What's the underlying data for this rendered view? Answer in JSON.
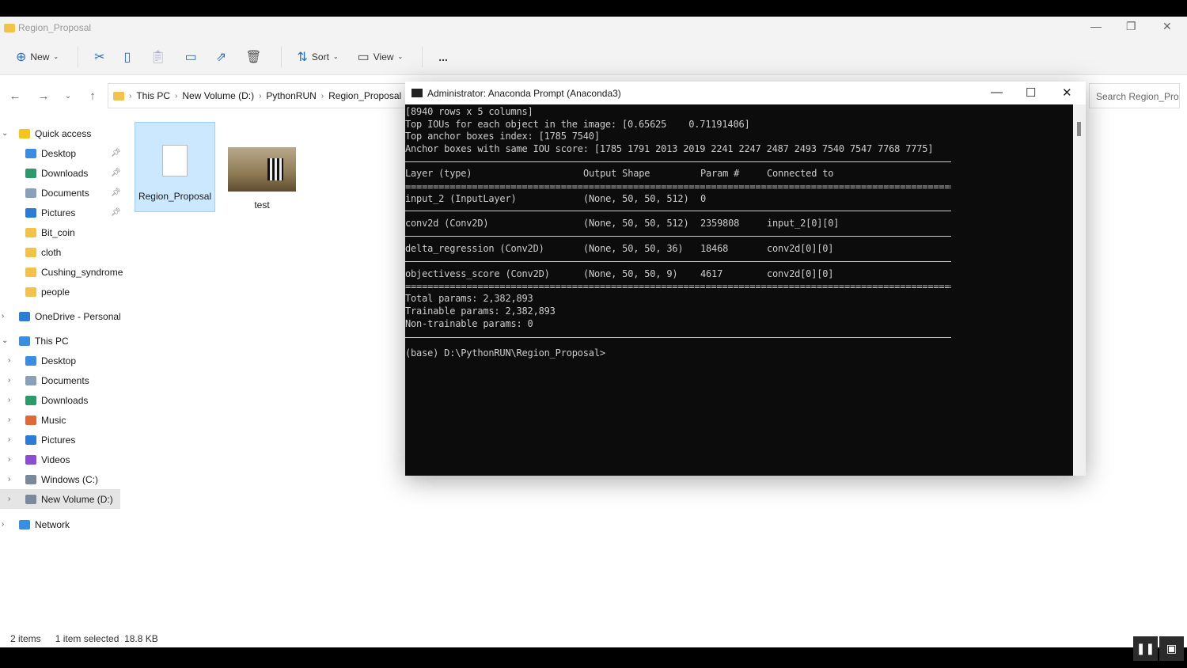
{
  "explorer": {
    "title": "Region_Proposal",
    "toolbar": {
      "new": "New",
      "sort": "Sort",
      "view": "View",
      "more": "..."
    },
    "breadcrumb": [
      "This PC",
      "New Volume (D:)",
      "PythonRUN",
      "Region_Proposal"
    ],
    "search_placeholder": "Search Region_Pro...",
    "sidebar": {
      "quick_access": "Quick access",
      "quick_items": [
        {
          "label": "Desktop",
          "pinned": true,
          "color": "#3a8de0"
        },
        {
          "label": "Downloads",
          "pinned": true,
          "color": "#2c9a6a"
        },
        {
          "label": "Documents",
          "pinned": true,
          "color": "#8aa0b8"
        },
        {
          "label": "Pictures",
          "pinned": true,
          "color": "#2e7bd6"
        },
        {
          "label": "Bit_coin",
          "pinned": false,
          "color": "#f3c24b"
        },
        {
          "label": "cloth",
          "pinned": false,
          "color": "#f3c24b"
        },
        {
          "label": "Cushing_syndrome",
          "pinned": false,
          "color": "#f3c24b"
        },
        {
          "label": "people",
          "pinned": false,
          "color": "#f3c24b"
        }
      ],
      "onedrive": "OneDrive - Personal",
      "this_pc": "This PC",
      "pc_items": [
        {
          "label": "Desktop",
          "color": "#3a8de0"
        },
        {
          "label": "Documents",
          "color": "#8aa0b8"
        },
        {
          "label": "Downloads",
          "color": "#2c9a6a"
        },
        {
          "label": "Music",
          "color": "#e0693a"
        },
        {
          "label": "Pictures",
          "color": "#2e7bd6"
        },
        {
          "label": "Videos",
          "color": "#8a4fd0"
        },
        {
          "label": "Windows (C:)",
          "color": "#7a8a9a"
        },
        {
          "label": "New Volume (D:)",
          "color": "#7a8a9a",
          "selected": true
        }
      ],
      "network": "Network"
    },
    "files": [
      {
        "name": "Region_Proposal",
        "type": "file",
        "selected": true
      },
      {
        "name": "test",
        "type": "image"
      }
    ],
    "status": {
      "count": "2 items",
      "selected": "1 item selected",
      "size": "18.8 KB"
    }
  },
  "terminal": {
    "title": "Administrator: Anaconda Prompt (Anaconda3)",
    "lines": [
      "[8940 rows x 5 columns]",
      "Top IOUs for each object in the image: [0.65625    0.71191406]",
      "Top anchor boxes index: [1785 7540]",
      "Anchor boxes with same IOU score: [1785 1791 2013 2019 2241 2247 2487 2493 7540 7547 7768 7775]"
    ],
    "headers": [
      "Layer (type)",
      "Output Shape",
      "Param #",
      "Connected to"
    ],
    "rows": [
      [
        "input_2 (InputLayer)",
        "(None, 50, 50, 512)",
        "0",
        ""
      ],
      [
        "conv2d (Conv2D)",
        "(None, 50, 50, 512)",
        "2359808",
        "input_2[0][0]"
      ],
      [
        "delta_regression (Conv2D)",
        "(None, 50, 50, 36)",
        "18468",
        "conv2d[0][0]"
      ],
      [
        "objectivess_score (Conv2D)",
        "(None, 50, 50, 9)",
        "4617",
        "conv2d[0][0]"
      ]
    ],
    "totals": [
      "Total params: 2,382,893",
      "Trainable params: 2,382,893",
      "Non-trainable params: 0"
    ],
    "prompt": "(base) D:\\PythonRUN\\Region_Proposal>"
  }
}
